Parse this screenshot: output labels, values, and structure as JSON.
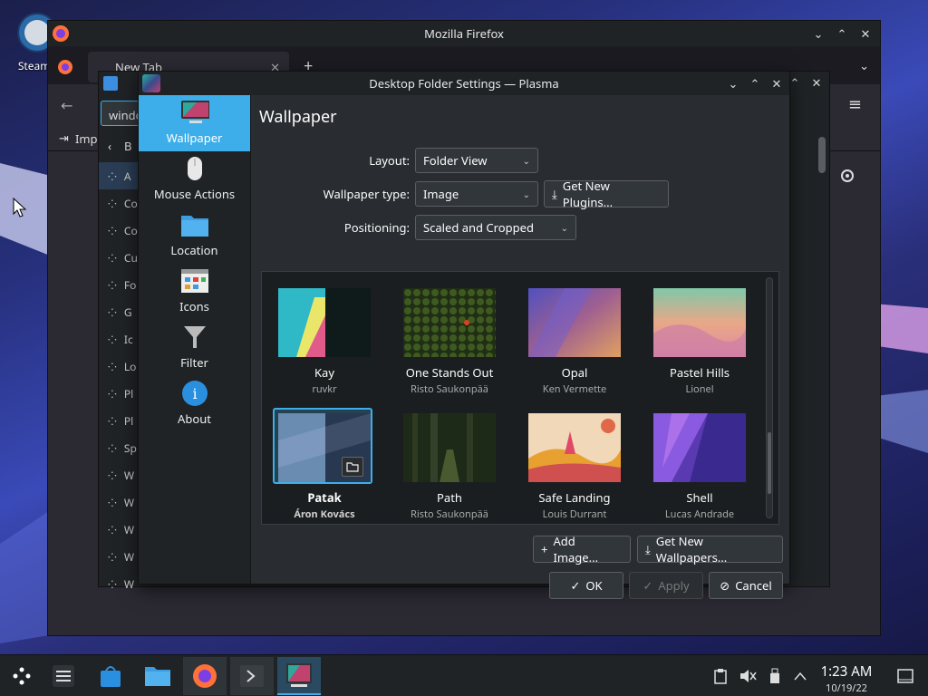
{
  "desktop": {
    "steam_label": "Steam ("
  },
  "firefox": {
    "title": "Mozilla Firefox",
    "tab_label": "New Tab",
    "address_partial": "windo",
    "bookmark_partial": "Imp"
  },
  "system_settings": {
    "back_label": "B",
    "rows": [
      "A",
      "Co",
      "Co",
      "Cu",
      "Fo",
      "G",
      "Ic",
      "Lo",
      "Pl",
      "Pl",
      "Sp",
      "W",
      "W",
      "W",
      "W",
      "W"
    ]
  },
  "dialog": {
    "title": "Desktop Folder Settings — Plasma",
    "categories": [
      {
        "label": "Wallpaper",
        "icon": "monitor-icon"
      },
      {
        "label": "Mouse Actions",
        "icon": "mouse-icon"
      },
      {
        "label": "Location",
        "icon": "folder-icon"
      },
      {
        "label": "Icons",
        "icon": "icons-grid-icon"
      },
      {
        "label": "Filter",
        "icon": "filter-icon"
      },
      {
        "label": "About",
        "icon": "info-icon"
      }
    ],
    "heading": "Wallpaper",
    "layout_label": "Layout:",
    "layout_value": "Folder View",
    "type_label": "Wallpaper type:",
    "type_value": "Image",
    "get_plugins": "Get New Plugins...",
    "positioning_label": "Positioning:",
    "positioning_value": "Scaled and Cropped",
    "wallpapers": [
      {
        "name": "Kay",
        "author": "ruvkr"
      },
      {
        "name": "One Stands Out",
        "author": "Risto Saukonpää"
      },
      {
        "name": "Opal",
        "author": "Ken Vermette"
      },
      {
        "name": "Pastel Hills",
        "author": "Lionel"
      },
      {
        "name": "Patak",
        "author": "Áron Kovács"
      },
      {
        "name": "Path",
        "author": "Risto Saukonpää"
      },
      {
        "name": "Safe Landing",
        "author": "Louis Durrant"
      },
      {
        "name": "Shell",
        "author": "Lucas Andrade"
      }
    ],
    "add_image": "Add Image...",
    "get_wallpapers": "Get New Wallpapers...",
    "ok": "OK",
    "apply": "Apply",
    "cancel": "Cancel"
  },
  "taskbar": {
    "time": "1:23 AM",
    "date": "10/19/22"
  },
  "colors": {
    "accent": "#3daee9",
    "window_bg": "#292c30",
    "titlebar": "#202326"
  }
}
